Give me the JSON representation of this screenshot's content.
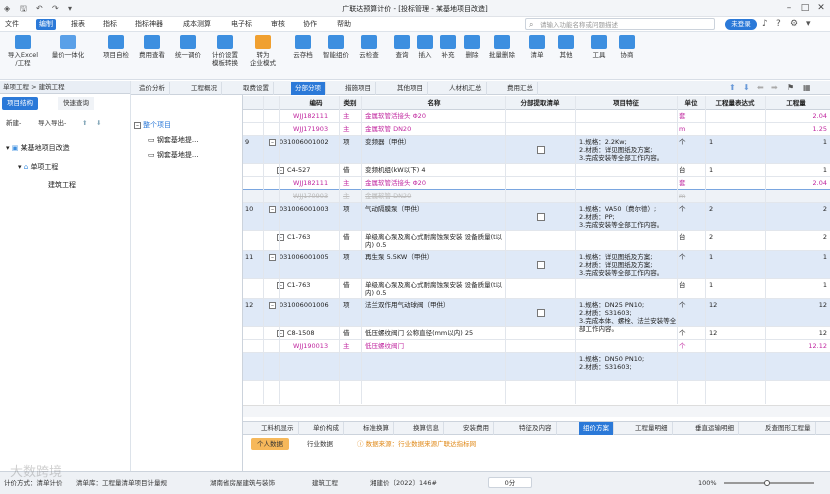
{
  "app": {
    "title": "广联达预算计价 - [投标管理 - 某基地项目改造]"
  },
  "menu": [
    "文件",
    "编制",
    "报表",
    "指标",
    "指标神器",
    "成本测算",
    "电子标",
    "审核",
    "协作",
    "帮助"
  ],
  "search": {
    "placeholder": "请输入功能名称或问题描述"
  },
  "login": "未登录",
  "ribbon": [
    {
      "label": "导入Excel",
      "label2": "/工程",
      "color": "#3d8fe0"
    },
    {
      "label": "量价一体化",
      "label2": "",
      "color": "#3d8fe0"
    },
    {
      "label": "项目自检",
      "label2": "",
      "color": "#3d8fe0"
    },
    {
      "label": "费用查看",
      "label2": "",
      "color": "#3d8fe0"
    },
    {
      "label": "统一调价",
      "label2": "",
      "color": "#3d8fe0"
    },
    {
      "label": "计价设置",
      "label2": "模板转换",
      "color": "#3d8fe0"
    },
    {
      "label": "转为",
      "label2": "企业模式",
      "color": "#f0a030"
    },
    {
      "label": "云存档",
      "label2": "",
      "color": "#3d8fe0"
    },
    {
      "label": "智能组价",
      "label2": "",
      "color": "#3d8fe0"
    },
    {
      "label": "云检查",
      "label2": "",
      "color": "#3d8fe0"
    },
    {
      "label": "查询",
      "label2": "",
      "color": "#3d8fe0"
    },
    {
      "label": "插入",
      "label2": "",
      "color": "#3d8fe0"
    },
    {
      "label": "补充",
      "label2": "",
      "color": "#3d8fe0"
    },
    {
      "label": "删除",
      "label2": "",
      "color": "#3d8fe0"
    },
    {
      "label": "批量删除",
      "label2": "",
      "color": "#3d8fe0"
    },
    {
      "label": "清单",
      "label2": "",
      "color": "#3d8fe0"
    },
    {
      "label": "其他",
      "label2": "",
      "color": "#3d8fe0"
    },
    {
      "label": "工具",
      "label2": "",
      "color": "#3d8fe0"
    },
    {
      "label": "协商",
      "label2": "",
      "color": "#3d8fe0"
    }
  ],
  "left": {
    "breadcrumb": "单项工程 > 建筑工程",
    "tabs": [
      "项目结构",
      "快速查询"
    ],
    "tools": {
      "new": "新建-",
      "import": "导入导出-"
    },
    "tree": [
      "某基地项目改造",
      "单项工程",
      "建筑工程"
    ],
    "mid_tree": [
      "整个项目",
      "钢套基地提...",
      "钢套基地提..."
    ]
  },
  "top_tabs": [
    "造价分析",
    "工程概况",
    "取费设置",
    "分部分项",
    "措施项目",
    "其他项目",
    "人材机汇总",
    "费用汇总"
  ],
  "grid": {
    "headers": [
      "编码",
      "类别",
      "名称",
      "分部提取清单",
      "项目特征",
      "单位",
      "工程量表达式",
      "工程量"
    ],
    "rows": [
      {
        "no": "",
        "code": "WJJ182111",
        "type": "主",
        "name": "金属软管活接头 Φ20",
        "feat": "",
        "unit": "套",
        "expr": "",
        "qty": "2.04",
        "style": "pink"
      },
      {
        "no": "",
        "code": "WJJ171903",
        "type": "主",
        "name": "金属软管 DN20",
        "feat": "",
        "unit": "m",
        "expr": "",
        "qty": "1.25",
        "style": "pink"
      },
      {
        "no": "9",
        "code": "031006001002",
        "type": "项",
        "name": "变频器（甲供）",
        "feat": "1.规格：2.2Kw;\n2.材质：详见图纸及方案;\n3.完成安装等全部工作内容。",
        "unit": "个",
        "expr": "1",
        "qty": "1",
        "style": "hl"
      },
      {
        "no": "",
        "code": "C4-527",
        "type": "借",
        "name": "变频机组(kW以下) 4",
        "feat": "",
        "unit": "台",
        "expr": "1",
        "qty": "1",
        "style": ""
      },
      {
        "no": "",
        "code": "WJJ182111",
        "type": "主",
        "name": "金属软管活接头 Φ20",
        "feat": "",
        "unit": "套",
        "expr": "",
        "qty": "2.04",
        "style": "pink"
      },
      {
        "no": "",
        "code": "WJJ170903",
        "type": "主",
        "name": "金属软管 DN20",
        "feat": "",
        "unit": "m",
        "expr": "",
        "qty": "",
        "style": "strike"
      },
      {
        "no": "10",
        "code": "031006001003",
        "type": "项",
        "name": "气动隔膜泵（甲供）",
        "feat": "1.规格：VA50（费尔德）;\n2.材质：PP;\n3.完成安装等全部工作内容。",
        "unit": "个",
        "expr": "2",
        "qty": "2",
        "style": "hl"
      },
      {
        "no": "",
        "code": "C1-763",
        "type": "借",
        "name": "单级离心泵及离心式耐腐蚀泵安装 设备质量(t以内) 0.5",
        "feat": "",
        "unit": "台",
        "expr": "2",
        "qty": "2",
        "style": ""
      },
      {
        "no": "11",
        "code": "031006001005",
        "type": "项",
        "name": "再生泵 5.5KW（甲供）",
        "feat": "1.规格：详见图纸及方案;\n2.材质：详见图纸及方案;\n3.完成安装等全部工作内容。",
        "unit": "个",
        "expr": "1",
        "qty": "1",
        "style": "hl"
      },
      {
        "no": "",
        "code": "C1-763",
        "type": "借",
        "name": "单级离心泵及离心式耐腐蚀泵安装 设备质量(t以内) 0.5",
        "feat": "",
        "unit": "台",
        "expr": "1",
        "qty": "1",
        "style": ""
      },
      {
        "no": "12",
        "code": "031006001006",
        "type": "项",
        "name": "法兰双作用气动球阀（甲供）",
        "feat": "1.规格：DN25 PN10;\n2.材质：S31603;\n3.完成本体、螺栓、法兰安装等全部工作内容。",
        "unit": "个",
        "expr": "12",
        "qty": "12",
        "style": "hl"
      },
      {
        "no": "",
        "code": "C8-1508",
        "type": "借",
        "name": "低压螺纹阀门 公称直径(mm以内) 25",
        "feat": "",
        "unit": "个",
        "expr": "12",
        "qty": "12",
        "style": ""
      },
      {
        "no": "",
        "code": "WJJ190013",
        "type": "主",
        "name": "低压螺纹阀门",
        "feat": "",
        "unit": "个",
        "expr": "",
        "qty": "12.12",
        "style": "pink"
      },
      {
        "no": "",
        "code": "",
        "type": "",
        "name": "",
        "feat": "1.规格：DN50 PN10;\n2.材质：S31603;",
        "unit": "",
        "expr": "",
        "qty": "",
        "style": "hl"
      }
    ]
  },
  "bottom_tabs": [
    "工料机显示",
    "单价构成",
    "标准换算",
    "换算信息",
    "安装费用",
    "特征及内容",
    "组价方案",
    "工程量明细",
    "垂直运输明细",
    "反查图形工程量"
  ],
  "sub_tabs": [
    "个人数据",
    "行业数据"
  ],
  "sub_note": "数据来源：行业数据来源广联达指标网",
  "status": {
    "method": "计价方式：清单计价",
    "rule": "清单库：工程量清单项目计量规",
    "quota": "湖南省房屋建筑与装饰",
    "project": "建筑工程",
    "file": "湘建价〔2022〕146#",
    "score": "0分",
    "zoom": "100%",
    "watermark": "大数跨境"
  }
}
